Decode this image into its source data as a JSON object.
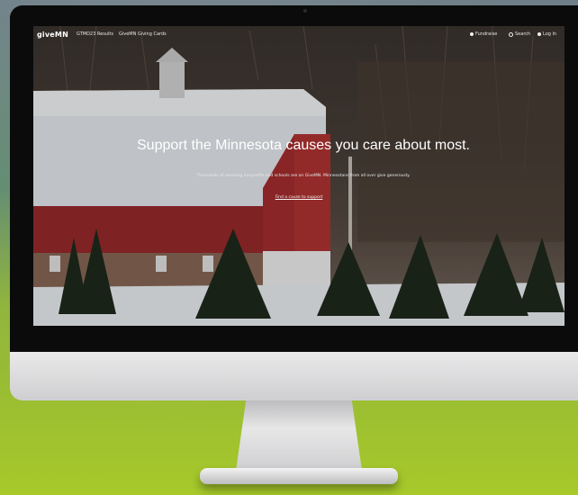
{
  "site": {
    "logo": "giveMN",
    "nav": {
      "results_link": "GTMD23 Results",
      "cards_link": "GiveMN Giving Cards",
      "fundraise_link": "Fundraise",
      "search_link": "Search",
      "login_link": "Log In"
    },
    "hero": {
      "headline": "Support the Minnesota causes you care about most.",
      "subtext": "Thousands of amazing nonprofits and schools are on GiveMN. Minnesotans from all over give generously.",
      "cta_label": "Find a cause to support"
    }
  },
  "icons": {
    "fundraise": "heart-icon",
    "search": "search-icon",
    "login": "user-icon"
  },
  "colors": {
    "barn_red": "#a0282b",
    "snow": "#f2f4f7",
    "background_green": "#a7c92a"
  }
}
